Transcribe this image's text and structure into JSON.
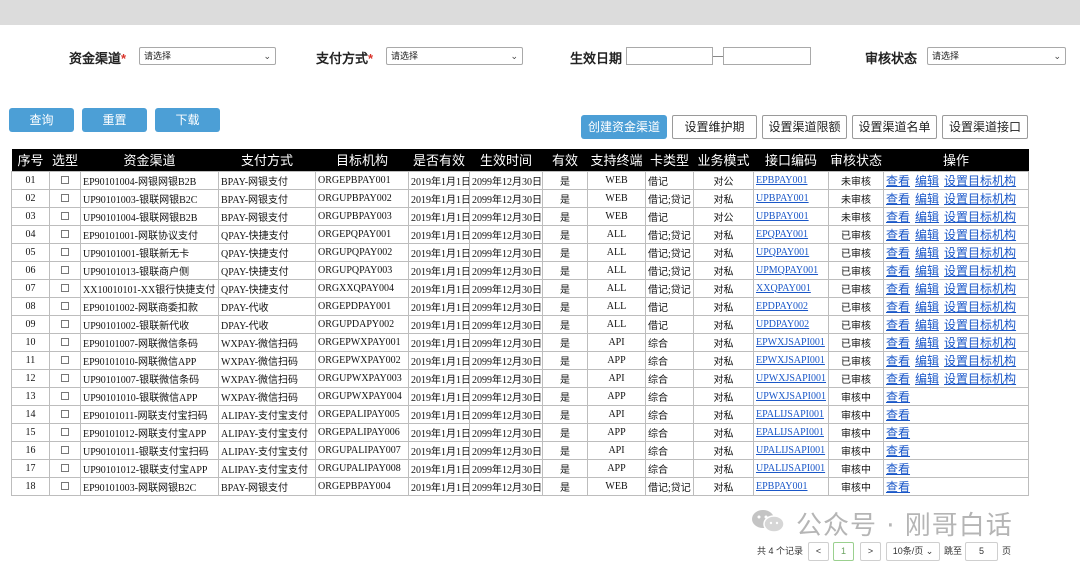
{
  "filters": {
    "channel_label": "资金渠道",
    "channel_required": "*",
    "channel_value": "请选择",
    "pay_label": "支付方式",
    "pay_required": "*",
    "pay_value": "请选择",
    "date_label": "生效日期",
    "audit_label": "审核状态",
    "audit_value": "请选择"
  },
  "buttons": {
    "query": "查询",
    "reset": "重置",
    "download": "下载",
    "create": "创建资金渠道",
    "maintenance": "设置维护期",
    "limit": "设置渠道限额",
    "namelist": "设置渠道名单",
    "interface": "设置渠道接口"
  },
  "table": {
    "headers": [
      "序号",
      "选型",
      "资金渠道",
      "支付方式",
      "目标机构",
      "是否有效",
      "生效时间",
      "有效",
      "支持终端",
      "卡类型",
      "业务模式",
      "接口编码",
      "审核状态",
      "操作"
    ],
    "op_view": "查看",
    "op_edit": "编辑",
    "op_target": "设置目标机构",
    "rows": [
      {
        "no": "01",
        "channel": "EP90101004-网银网银B2B",
        "pay": "BPAY-网银支付",
        "org": "ORGEPBPAY001",
        "start": "2019年1月1日",
        "end": "2099年12月30日",
        "valid": "是",
        "term": "WEB",
        "card": "借记",
        "mode": "对公",
        "code": "EPBPAY001",
        "status": "未审核",
        "full": true
      },
      {
        "no": "02",
        "channel": "UP90101003-银联网银B2C",
        "pay": "BPAY-网银支付",
        "org": "ORGUPBPAY002",
        "start": "2019年1月1日",
        "end": "2099年12月30日",
        "valid": "是",
        "term": "WEB",
        "card": "借记;贷记",
        "mode": "对私",
        "code": "UPBPAY001",
        "status": "未审核",
        "full": true
      },
      {
        "no": "03",
        "channel": "UP90101004-银联网银B2B",
        "pay": "BPAY-网银支付",
        "org": "ORGUPBPAY003",
        "start": "2019年1月1日",
        "end": "2099年12月30日",
        "valid": "是",
        "term": "WEB",
        "card": "借记",
        "mode": "对公",
        "code": "UPBPAY001",
        "status": "未审核",
        "full": true
      },
      {
        "no": "04",
        "channel": "EP90101001-网联协议支付",
        "pay": "QPAY-快捷支付",
        "org": "ORGEPQPAY001",
        "start": "2019年1月1日",
        "end": "2099年12月30日",
        "valid": "是",
        "term": "ALL",
        "card": "借记;贷记",
        "mode": "对私",
        "code": "EPQPAY001",
        "status": "已审核",
        "full": true
      },
      {
        "no": "05",
        "channel": "UP90101001-银联新无卡",
        "pay": "QPAY-快捷支付",
        "org": "ORGUPQPAY002",
        "start": "2019年1月1日",
        "end": "2099年12月30日",
        "valid": "是",
        "term": "ALL",
        "card": "借记;贷记",
        "mode": "对私",
        "code": "UPQPAY001",
        "status": "已审核",
        "full": true
      },
      {
        "no": "06",
        "channel": "UP90101013-银联商户侧",
        "pay": "QPAY-快捷支付",
        "org": "ORGUPQPAY003",
        "start": "2019年1月1日",
        "end": "2099年12月30日",
        "valid": "是",
        "term": "ALL",
        "card": "借记;贷记",
        "mode": "对私",
        "code": "UPMQPAY001",
        "status": "已审核",
        "full": true
      },
      {
        "no": "07",
        "channel": "XX10010101-XX银行快捷支付",
        "pay": "QPAY-快捷支付",
        "org": "ORGXXQPAY004",
        "start": "2019年1月1日",
        "end": "2099年12月30日",
        "valid": "是",
        "term": "ALL",
        "card": "借记;贷记",
        "mode": "对私",
        "code": "XXQPAY001",
        "status": "已审核",
        "full": true
      },
      {
        "no": "08",
        "channel": "EP90101002-网联商委扣款",
        "pay": "DPAY-代收",
        "org": "ORGEPDPAY001",
        "start": "2019年1月1日",
        "end": "2099年12月30日",
        "valid": "是",
        "term": "ALL",
        "card": "借记",
        "mode": "对私",
        "code": "EPDPAY002",
        "status": "已审核",
        "full": true
      },
      {
        "no": "09",
        "channel": "UP90101002-银联新代收",
        "pay": "DPAY-代收",
        "org": "ORGUPDAPY002",
        "start": "2019年1月1日",
        "end": "2099年12月30日",
        "valid": "是",
        "term": "ALL",
        "card": "借记",
        "mode": "对私",
        "code": "UPDPAY002",
        "status": "已审核",
        "full": true
      },
      {
        "no": "10",
        "channel": "EP90101007-网联微信条码",
        "pay": "WXPAY-微信扫码",
        "org": "ORGEPWXPAY001",
        "start": "2019年1月1日",
        "end": "2099年12月30日",
        "valid": "是",
        "term": "API",
        "card": "综合",
        "mode": "对私",
        "code": "EPWXJSAPI001",
        "status": "已审核",
        "full": true
      },
      {
        "no": "11",
        "channel": "EP90101010-网联微信APP",
        "pay": "WXPAY-微信扫码",
        "org": "ORGEPWXPAY002",
        "start": "2019年1月1日",
        "end": "2099年12月30日",
        "valid": "是",
        "term": "APP",
        "card": "综合",
        "mode": "对私",
        "code": "EPWXJSAPI001",
        "status": "已审核",
        "full": true
      },
      {
        "no": "12",
        "channel": "UP90101007-银联微信条码",
        "pay": "WXPAY-微信扫码",
        "org": "ORGUPWXPAY003",
        "start": "2019年1月1日",
        "end": "2099年12月30日",
        "valid": "是",
        "term": "API",
        "card": "综合",
        "mode": "对私",
        "code": "UPWXJSAPI001",
        "status": "已审核",
        "full": true
      },
      {
        "no": "13",
        "channel": "UP90101010-银联微信APP",
        "pay": "WXPAY-微信扫码",
        "org": "ORGUPWXPAY004",
        "start": "2019年1月1日",
        "end": "2099年12月30日",
        "valid": "是",
        "term": "APP",
        "card": "综合",
        "mode": "对私",
        "code": "UPWXJSAPI001",
        "status": "审核中",
        "full": false
      },
      {
        "no": "14",
        "channel": "EP90101011-网联支付宝扫码",
        "pay": "ALIPAY-支付宝支付",
        "org": "ORGEPALIPAY005",
        "start": "2019年1月1日",
        "end": "2099年12月30日",
        "valid": "是",
        "term": "API",
        "card": "综合",
        "mode": "对私",
        "code": "EPALIJSAPI001",
        "status": "审核中",
        "full": false
      },
      {
        "no": "15",
        "channel": "EP90101012-网联支付宝APP",
        "pay": "ALIPAY-支付宝支付",
        "org": "ORGEPALIPAY006",
        "start": "2019年1月1日",
        "end": "2099年12月30日",
        "valid": "是",
        "term": "APP",
        "card": "综合",
        "mode": "对私",
        "code": "EPALIJSAPI001",
        "status": "审核中",
        "full": false
      },
      {
        "no": "16",
        "channel": "UP90101011-银联支付宝扫码",
        "pay": "ALIPAY-支付宝支付",
        "org": "ORGUPALIPAY007",
        "start": "2019年1月1日",
        "end": "2099年12月30日",
        "valid": "是",
        "term": "API",
        "card": "综合",
        "mode": "对私",
        "code": "UPALIJSAPI001",
        "status": "审核中",
        "full": false
      },
      {
        "no": "17",
        "channel": "UP90101012-银联支付宝APP",
        "pay": "ALIPAY-支付宝支付",
        "org": "ORGUPALIPAY008",
        "start": "2019年1月1日",
        "end": "2099年12月30日",
        "valid": "是",
        "term": "APP",
        "card": "综合",
        "mode": "对私",
        "code": "UPALIJSAPI001",
        "status": "审核中",
        "full": false
      },
      {
        "no": "18",
        "channel": "EP90101003-网联网银B2C",
        "pay": "BPAY-网银支付",
        "org": "ORGEPBPAY004",
        "start": "2019年1月1日",
        "end": "2099年12月30日",
        "valid": "是",
        "term": "WEB",
        "card": "借记;贷记",
        "mode": "对私",
        "code": "EPBPAY001",
        "status": "审核中",
        "full": false
      }
    ]
  },
  "watermark": "公众号 · 刚哥白话",
  "pagination": {
    "total": "共 4 个记录",
    "prev": "<",
    "current": "1",
    "next": ">",
    "per_page": "10条/页",
    "goto_label": "跳至",
    "goto_value": "5",
    "page_suffix": "页"
  }
}
